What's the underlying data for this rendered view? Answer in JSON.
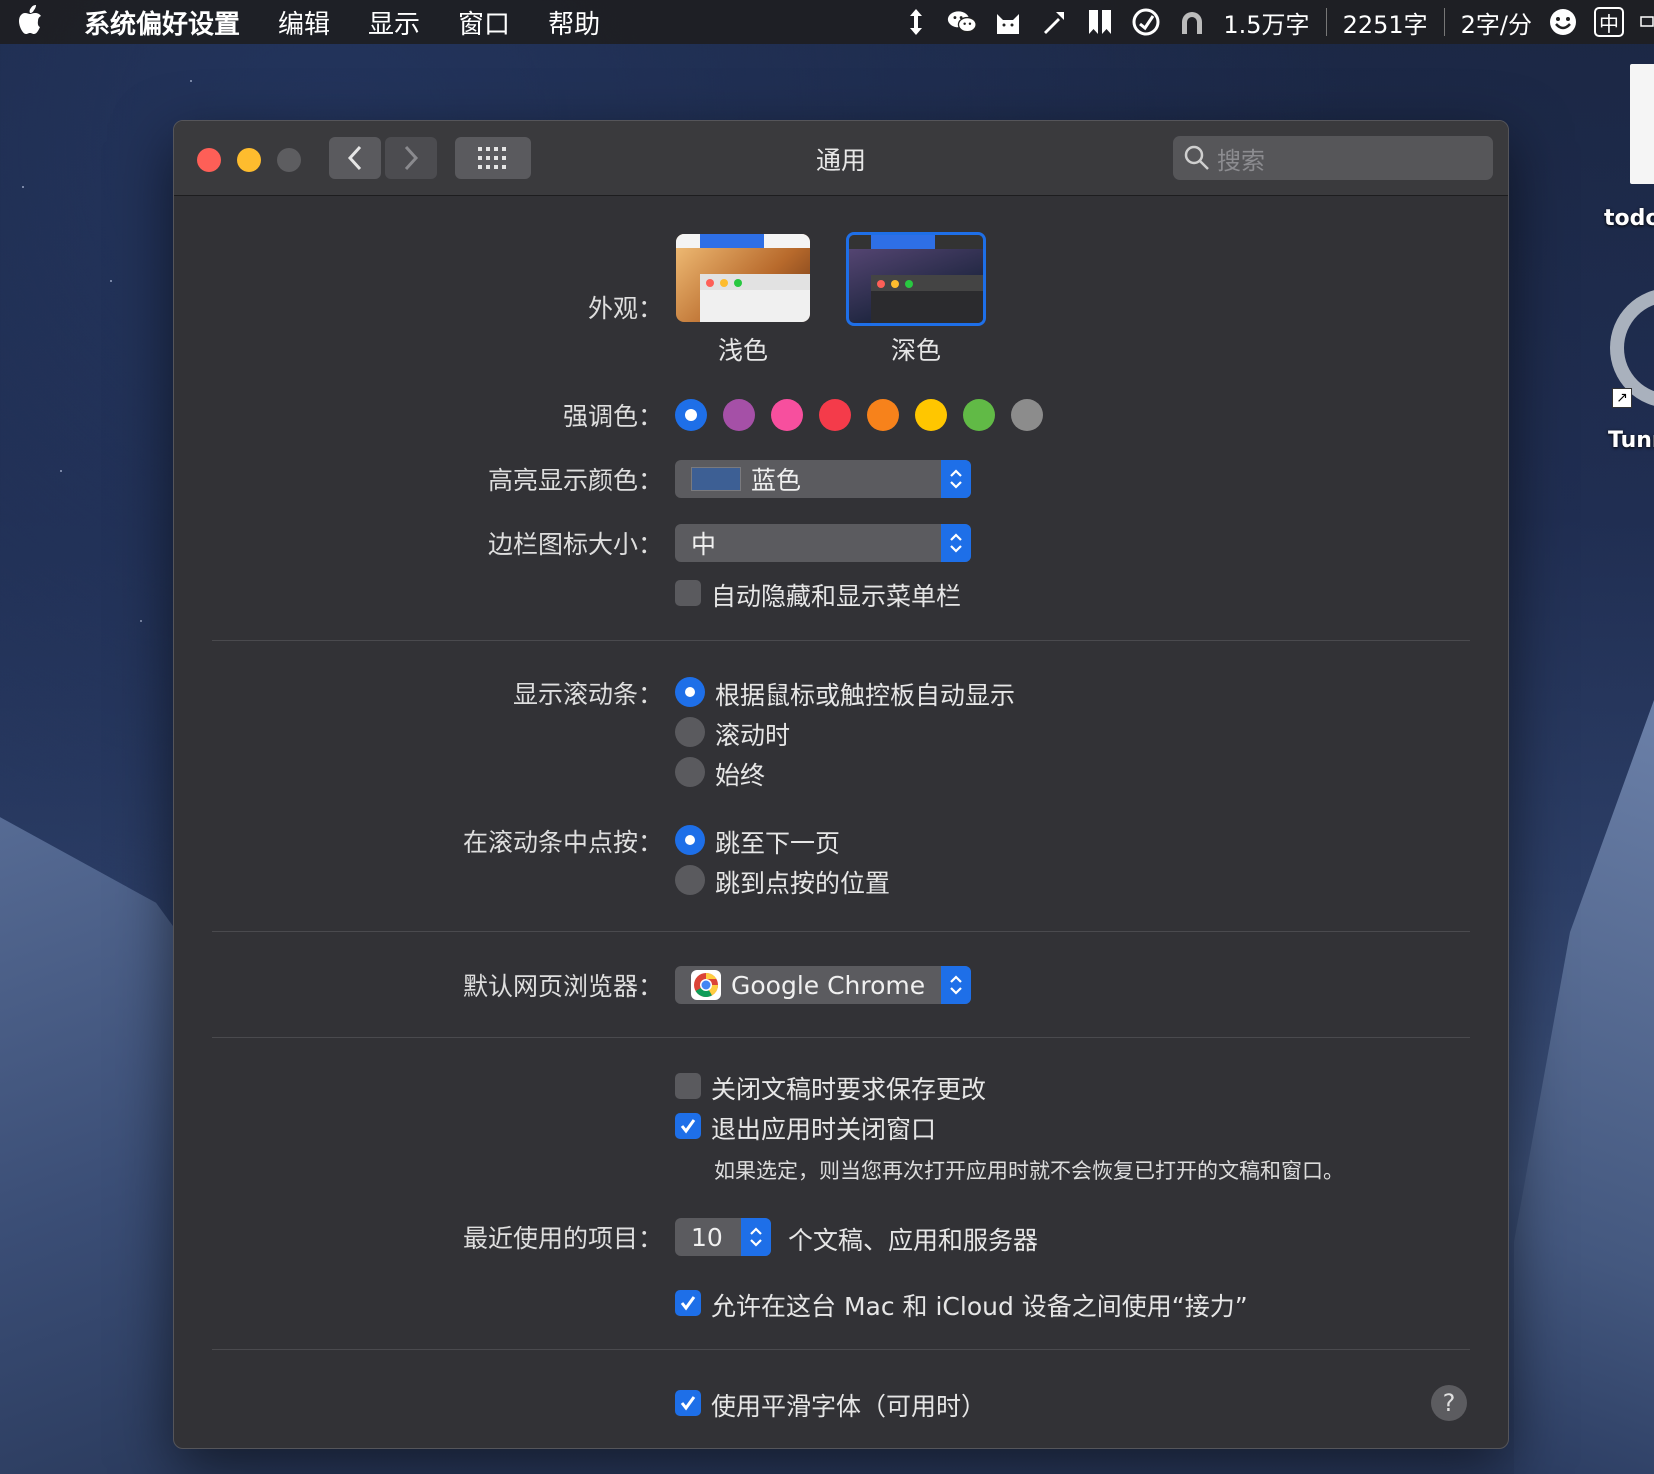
{
  "menubar": {
    "app_name": "系统偏好设置",
    "items": [
      "编辑",
      "显示",
      "窗口",
      "帮助"
    ],
    "status": {
      "count_1": "1.5万字",
      "count_2": "2251字",
      "count_3": "2字/分",
      "ime": "中"
    }
  },
  "desktop": {
    "item_1_label": "todo",
    "item_2_label": "Tunn"
  },
  "window": {
    "title": "通用",
    "search_placeholder": "搜索"
  },
  "appearance": {
    "label": "外观：",
    "options": [
      "浅色",
      "深色"
    ],
    "selected": "深色"
  },
  "accent": {
    "label": "强调色：",
    "colors": [
      "#1e6fe8",
      "#a550a7",
      "#f74f9e",
      "#f43b4a",
      "#f7821b",
      "#ffc600",
      "#61ba46",
      "#8c8c8c"
    ],
    "selected_index": 0
  },
  "highlight": {
    "label": "高亮显示颜色：",
    "value": "蓝色",
    "swatch": "#3d5f94"
  },
  "sidebar_icon": {
    "label": "边栏图标大小：",
    "value": "中"
  },
  "menu_bar_autohide": {
    "label": "自动隐藏和显示菜单栏",
    "checked": false
  },
  "scrollbars": {
    "label": "显示滚动条：",
    "options": [
      "根据鼠标或触控板自动显示",
      "滚动时",
      "始终"
    ],
    "selected_index": 0
  },
  "scroll_click": {
    "label": "在滚动条中点按：",
    "options": [
      "跳至下一页",
      "跳到点按的位置"
    ],
    "selected_index": 0
  },
  "browser": {
    "label": "默认网页浏览器：",
    "value": "Google Chrome"
  },
  "documents": {
    "ask_save_label": "关闭文稿时要求保存更改",
    "ask_save_checked": false,
    "close_windows_label": "退出应用时关闭窗口",
    "close_windows_checked": true,
    "close_windows_note": "如果选定，则当您再次打开应用时就不会恢复已打开的文稿和窗口。"
  },
  "recent": {
    "label": "最近使用的项目：",
    "value": "10",
    "suffix": "个文稿、应用和服务器"
  },
  "handoff": {
    "label": "允许在这台 Mac 和 iCloud 设备之间使用“接力”",
    "checked": true
  },
  "font_smoothing": {
    "label": "使用平滑字体（可用时）",
    "checked": true
  },
  "help": {
    "label": "?"
  }
}
